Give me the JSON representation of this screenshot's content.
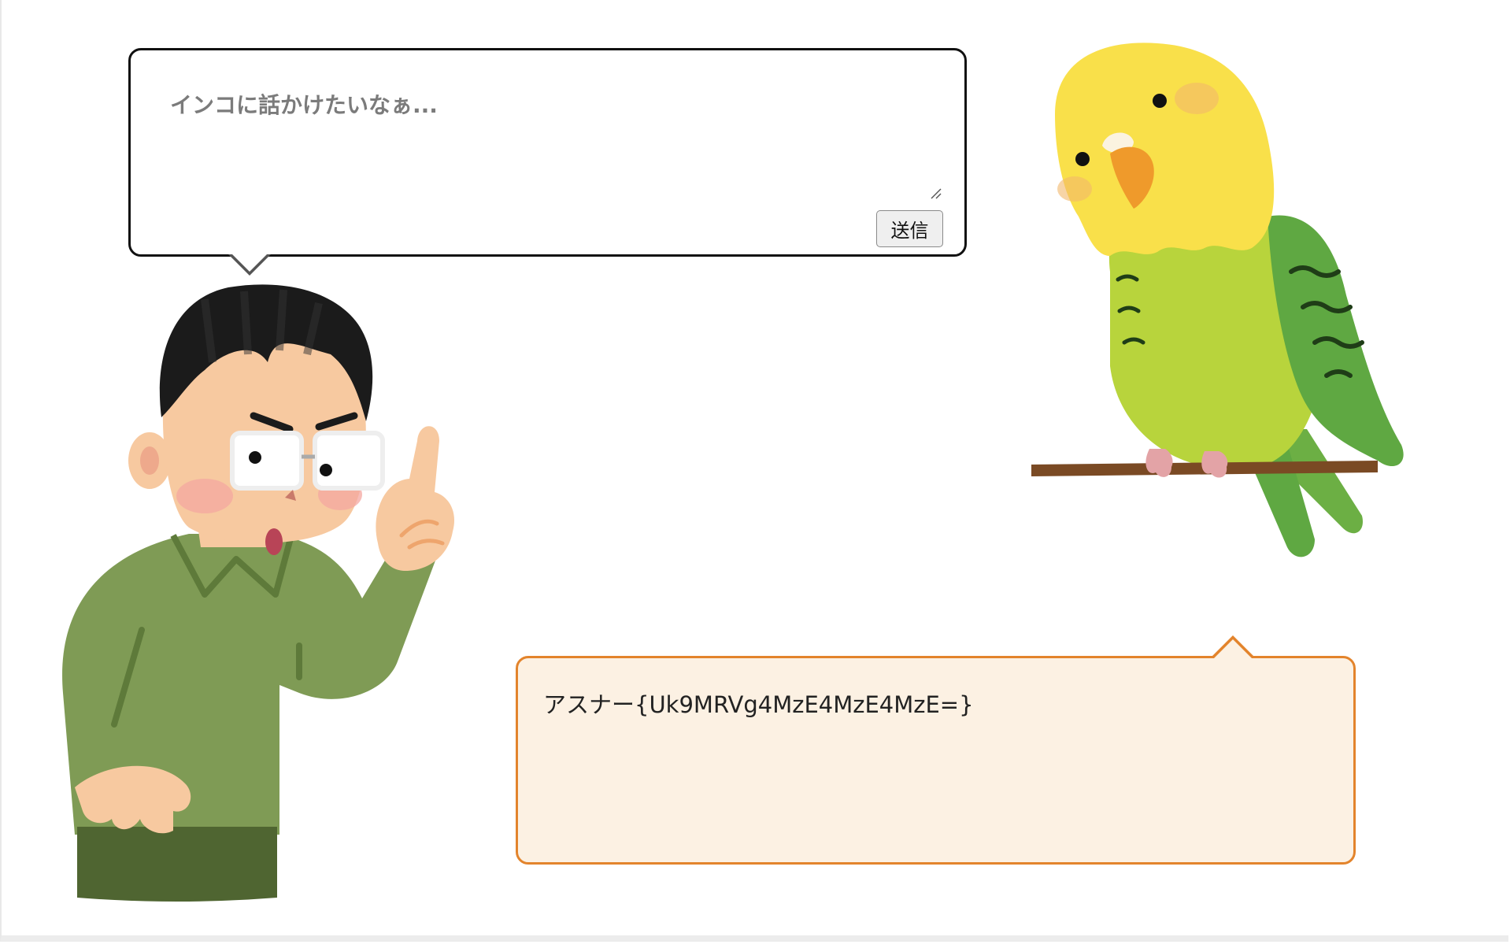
{
  "chat": {
    "input_placeholder": "インコに話かけたいなぁ...",
    "input_value": "",
    "send_label": "送信",
    "answer_text": "アスナー{Uk9MRVg4MzE4MzE4MzE=}"
  },
  "colors": {
    "input_border": "#111111",
    "answer_border": "#e3842c",
    "answer_background": "#fcf1e3",
    "man_shirt": "#7f9b55",
    "parrot_head": "#f9e04a",
    "parrot_body": "#b8d43c",
    "parrot_wing": "#5fa842"
  },
  "icons": {
    "man": "man-pointing-icon",
    "parrot": "budgerigar-icon",
    "resize": "resize-grip-icon"
  }
}
